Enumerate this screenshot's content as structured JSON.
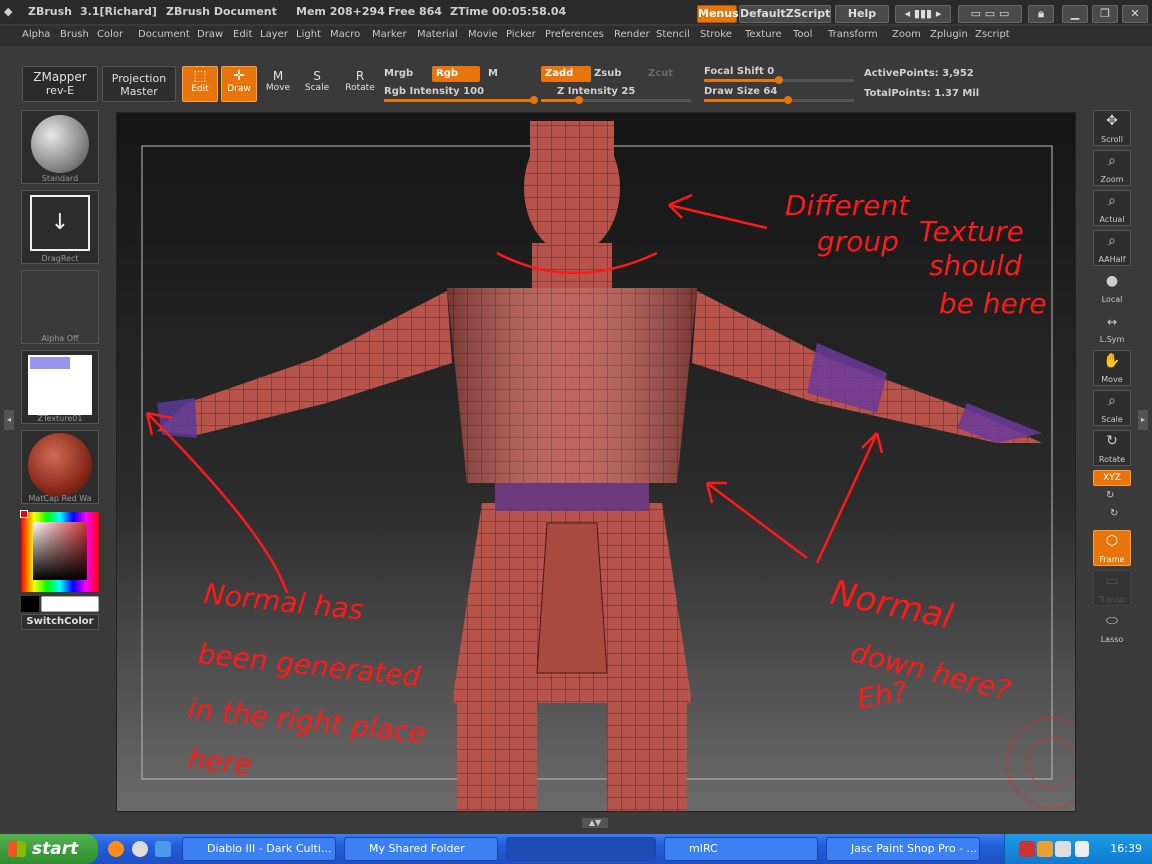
{
  "titlebar": {
    "app": "ZBrush",
    "version": "3.1[Richard]",
    "document": "ZBrush Document",
    "mem": "Mem 208+294",
    "free": "Free 864",
    "ztime": "ZTime 00:05:58.04",
    "menus_btn": "Menus",
    "script_btn": "DefaultZScript",
    "help_btn": "Help"
  },
  "menubar": {
    "items": [
      "Alpha",
      "Brush",
      "Color",
      "Document",
      "Draw",
      "Edit",
      "Layer",
      "Light",
      "Macro",
      "Marker",
      "Material",
      "Movie",
      "Picker",
      "Preferences",
      "Render",
      "Stencil",
      "Stroke",
      "Texture",
      "Tool",
      "Transform",
      "Zoom",
      "Zplugin",
      "Zscript"
    ]
  },
  "toolbar": {
    "zmapper": "ZMapper",
    "zmapper_sub": "rev-E",
    "projection": "Projection",
    "projection_sub": "Master",
    "edit": "Edit",
    "draw": "Draw",
    "move": "Move",
    "scale": "Scale",
    "rotate": "Rotate",
    "mrgb": "Mrgb",
    "rgb": "Rgb",
    "m": "M",
    "rgb_intensity": "Rgb Intensity 100",
    "zadd": "Zadd",
    "zsub": "Zsub",
    "zcut": "Zcut",
    "z_intensity": "Z Intensity 25",
    "focal_shift": "Focal Shift 0",
    "draw_size": "Draw Size 64",
    "active_points": "ActivePoints: 3,952",
    "total_points": "TotalPoints: 1.37 Mil",
    "rgb_intensity_value": 1.0,
    "z_intensity_value": 0.25,
    "focal_value": 0.0,
    "draw_size_value": 0.06
  },
  "lefttray": {
    "standard": "Standard",
    "dragrect": "DragRect",
    "alpha_off": "Alpha Off",
    "ztexture": "ZTexture01",
    "matcap": "MatCap Red Wa",
    "switch_color": "SwitchColor"
  },
  "annotations": {
    "a1_l1": "Different",
    "a1_l2": "group",
    "a1_l3": "Texture",
    "a1_l4": "should",
    "a1_l5": "be here",
    "a2_l1": "Normal has",
    "a2_l2": "been generated",
    "a2_l3": "in the right place",
    "a2_l4": "here",
    "a3_l1": "Normal",
    "a3_l2": "down here?",
    "a3_l3": "Eh?"
  },
  "righttray": {
    "scroll": "Scroll",
    "zoom": "Zoom",
    "actual": "Actual",
    "aahalf": "AAHalf",
    "local": "Local",
    "lsym": "L.Sym",
    "move": "Move",
    "scale": "Scale",
    "rotate": "Rotate",
    "xyz": "XYZ",
    "frame": "Frame",
    "transp": "Transp",
    "lasso": "Lasso"
  },
  "taskbar": {
    "start": "start",
    "tasks": [
      "Diablo III - Dark Culti...",
      "My Shared Folder",
      "",
      "mIRC",
      "Jasc Paint Shop Pro - ..."
    ],
    "clock": "16:39"
  },
  "colors": {
    "accent": "#e8750b",
    "annotation": "#ff1a1a",
    "mesh": "#b8544c"
  }
}
